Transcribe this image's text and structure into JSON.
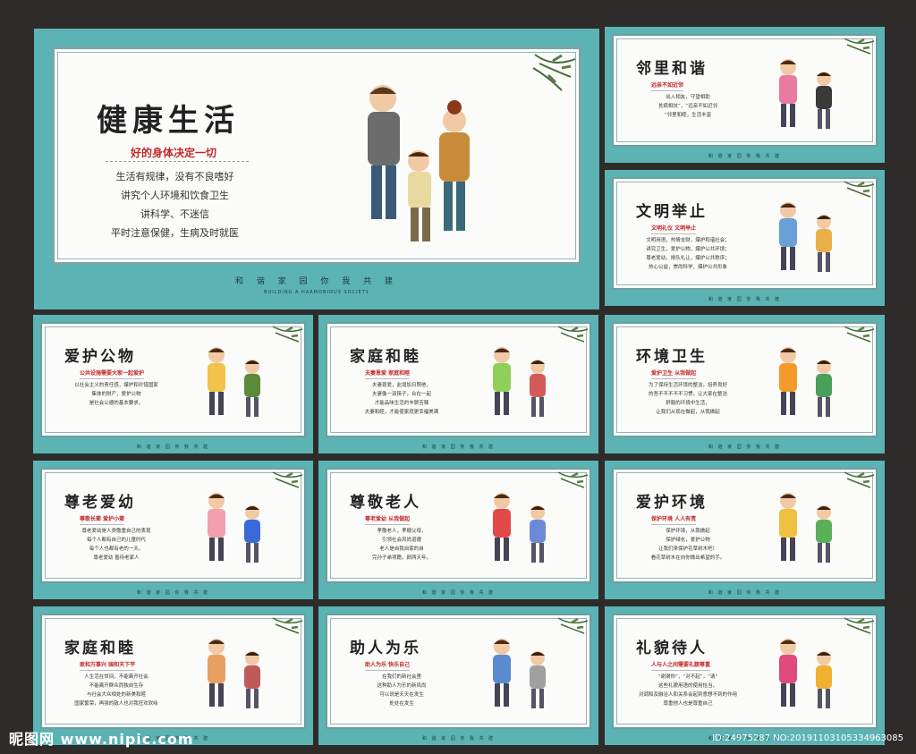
{
  "main": {
    "title": "健康生活",
    "subtitle": "好的身体决定一切",
    "lines": [
      "生活有规律，没有不良嗜好",
      "讲究个人环境和饮食卫生",
      "讲科学、不迷信",
      "平时注意保健，生病及时就医"
    ],
    "footer": "和 谐 家 园 你 我 共 建",
    "footer_en": "BUILDING A HARMONIOUS SOCIETY"
  },
  "panels": [
    {
      "title": "邻里和谐",
      "subtitle": "远亲不如近邻",
      "lines": [
        "出入相友，守望相助",
        "贫病相扶”，“远亲不如近邻",
        "“邻里和睦，生活丰富"
      ]
    },
    {
      "title": "文明举止",
      "subtitle": "文明礼仪 文明举止",
      "lines": [
        "文明用语，热情支财，爆护和谐社会；",
        "讲究卫生，爱护公物，爆护公共环境；",
        "尊老爱幼，排队礼让，爆护公共秩序；",
        "热心公益，崇尚科学，爆护公共形象"
      ]
    },
    {
      "title": "爱护公物",
      "subtitle": "公共设施需要大家一起爱护",
      "lines": [
        "以社会主义的责任感，爆护和珍惜国家",
        "集体的财产，爱护公物",
        "是社会公德的基本要求。"
      ]
    },
    {
      "title": "家庭和睦",
      "subtitle": "夫妻恩爱 家庭和睦",
      "lines": [
        "夫妻恩爱，此增加日照他，",
        "夫妻像一双筷子，合在一起",
        "才能品味生活的丰腴苦辣",
        "夫妻和睦，才能使家庭更幸福美满"
      ]
    },
    {
      "title": "环境卫生",
      "subtitle": "爱护卫生 从我做起",
      "lines": [
        "为了保持生活环境的整洁，培养良好",
        "的吾不不不不不习惯，让大家在整洁",
        "舒服的环境中生活，",
        "让我们从现在做起，从我做起"
      ]
    },
    {
      "title": "尊老爱幼",
      "subtitle": "尊敬长辈 爱护小辈",
      "lines": [
        "尊老爱幼是人类敬重自己的表现",
        "每个人都有自己的儿童时代",
        "每个人也都有老的一天。",
        "尊老爱幼 善待老家人"
      ]
    },
    {
      "title": "尊敬老人",
      "subtitle": "尊老爱幼 从我做起",
      "lines": [
        "孝敬老人，孝顺父母，",
        "引领社会风尚道德",
        "老人是自我自家的自",
        "完孙子弟项籍，颜两天年。"
      ]
    },
    {
      "title": "爱护环境",
      "subtitle": "保护环境 人人有责",
      "lines": [
        "保护环境，从我做起",
        "保护绿化，爱护公物",
        "让我们来保护花草树木吧！",
        "看花草树木在向你微出希望的手。"
      ]
    },
    {
      "title": "家庭和睦",
      "subtitle": "家和万事兴 国和天下平",
      "lines": [
        "人生活在世间，不能离开社会",
        "不能离开群众而独自生存",
        "与社会大众相处的新美和睦",
        "国家繁荣，再强的敌人也对我狂欢欢咏"
      ]
    },
    {
      "title": "助人为乐",
      "subtitle": "助人为乐 快乐自己",
      "lines": [
        "在我们的新社会里",
        "这种助人为乐的新风尚",
        "可以说是天天在发生",
        "处处在发生"
      ]
    },
    {
      "title": "礼貌待人",
      "subtitle": "人与人之间需要礼貌尊重",
      "lines": [
        "“谢谢你”，“对不起”，“请”",
        "这些礼貌用语的使用恰当，",
        "对调和及融洽人和关系会起到意想不到的作用",
        "尊重他人也是尊重自己"
      ]
    }
  ],
  "panel_footer": "和 谐 家 园 你 我 共 建",
  "watermark": {
    "site": "昵图网 www.nipic.com",
    "id": "ID:24975287 NO:20191103105334963085"
  },
  "colors": {
    "teal": "#5bb3b4",
    "red": "#c0282a",
    "bg": "#2f2b2a"
  }
}
